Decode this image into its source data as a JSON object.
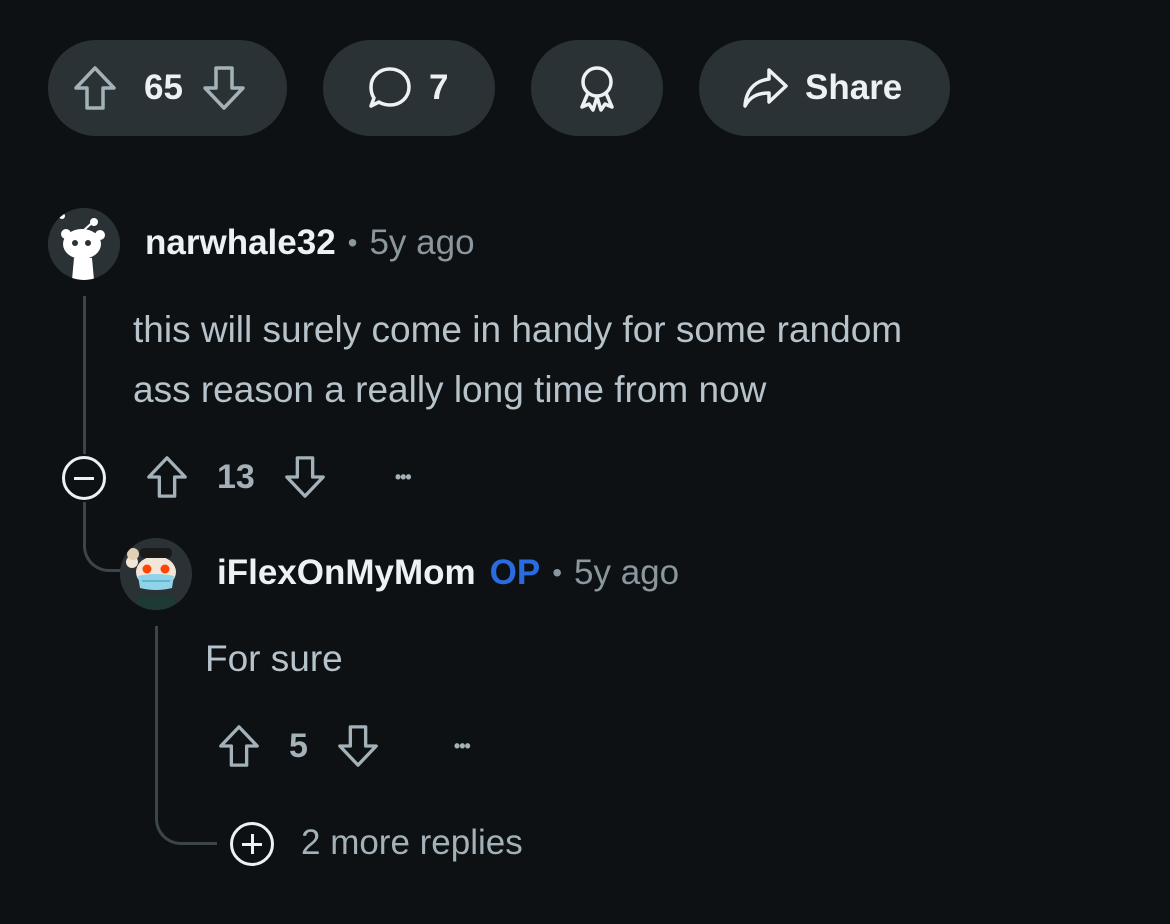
{
  "post_actions": {
    "upvotes": "65",
    "comments": "7",
    "share_label": "Share"
  },
  "comments": [
    {
      "username": "narwhale32",
      "time": "5y ago",
      "body_line1": "this will surely come in handy for some random",
      "body_line2": "ass reason a really long time from now",
      "score": "13",
      "more": "•••"
    },
    {
      "username": "iFlexOnMyMom",
      "op_badge": "OP",
      "time": "5y ago",
      "body": "For sure",
      "score": "5",
      "more": "•••",
      "more_replies": "2 more replies"
    }
  ],
  "separator": "•",
  "colors": {
    "background": "#0e1113",
    "pill": "#2a3236",
    "op_badge": "#2a6be0",
    "text": "#b7c3cb"
  }
}
